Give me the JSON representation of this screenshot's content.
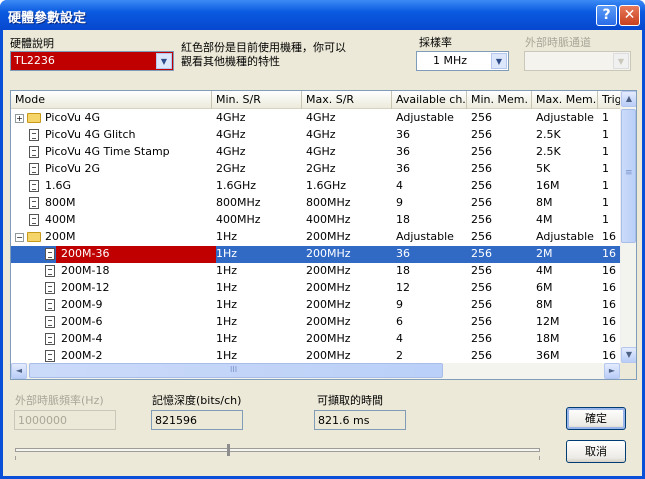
{
  "window": {
    "title": "硬體參數設定",
    "help_glyph": "?",
    "close_glyph": "✕"
  },
  "hardware": {
    "label": "硬體說明",
    "selected": "TL2236",
    "hint_line1": "紅色部份是目前使用機種，你可以",
    "hint_line2": "觀看其他機種的特性"
  },
  "sampling": {
    "label": "採樣率",
    "selected": "1 MHz"
  },
  "ext_clock_channel": {
    "label": "外部時脈通道",
    "selected": ""
  },
  "table": {
    "columns": [
      "Mode",
      "Min. S/R",
      "Max. S/R",
      "Available ch.",
      "Min. Mem.",
      "Max. Mem.",
      "Trig"
    ],
    "rows": [
      {
        "expander": "+",
        "icon": "folder",
        "indent": 0,
        "cells": [
          "PicoVu 4G",
          "4GHz",
          "4GHz",
          "Adjustable",
          "256",
          "Adjustable",
          "1"
        ]
      },
      {
        "expander": "",
        "icon": "doc",
        "indent": 0,
        "cells": [
          "PicoVu 4G Glitch",
          "4GHz",
          "4GHz",
          "36",
          "256",
          "2.5K",
          "1"
        ]
      },
      {
        "expander": "",
        "icon": "doc",
        "indent": 0,
        "cells": [
          "PicoVu 4G Time Stamp",
          "4GHz",
          "4GHz",
          "36",
          "256",
          "2.5K",
          "1"
        ]
      },
      {
        "expander": "",
        "icon": "doc",
        "indent": 0,
        "cells": [
          "PicoVu 2G",
          "2GHz",
          "2GHz",
          "36",
          "256",
          "5K",
          "1"
        ]
      },
      {
        "expander": "",
        "icon": "doc",
        "indent": 0,
        "cells": [
          "1.6G",
          "1.6GHz",
          "1.6GHz",
          "4",
          "256",
          "16M",
          "1"
        ]
      },
      {
        "expander": "",
        "icon": "doc",
        "indent": 0,
        "cells": [
          "800M",
          "800MHz",
          "800MHz",
          "9",
          "256",
          "8M",
          "1"
        ]
      },
      {
        "expander": "",
        "icon": "doc",
        "indent": 0,
        "cells": [
          "400M",
          "400MHz",
          "400MHz",
          "18",
          "256",
          "4M",
          "1"
        ]
      },
      {
        "expander": "−",
        "icon": "folder-open",
        "indent": 0,
        "cells": [
          "200M",
          "1Hz",
          "200MHz",
          "Adjustable",
          "256",
          "Adjustable",
          "16"
        ]
      },
      {
        "expander": "",
        "icon": "doc",
        "indent": 1,
        "selected": true,
        "current": true,
        "cells": [
          "200M-36",
          "1Hz",
          "200MHz",
          "36",
          "256",
          "2M",
          "16"
        ]
      },
      {
        "expander": "",
        "icon": "doc",
        "indent": 1,
        "cells": [
          "200M-18",
          "1Hz",
          "200MHz",
          "18",
          "256",
          "4M",
          "16"
        ]
      },
      {
        "expander": "",
        "icon": "doc",
        "indent": 1,
        "cells": [
          "200M-12",
          "1Hz",
          "200MHz",
          "12",
          "256",
          "6M",
          "16"
        ]
      },
      {
        "expander": "",
        "icon": "doc",
        "indent": 1,
        "cells": [
          "200M-9",
          "1Hz",
          "200MHz",
          "9",
          "256",
          "8M",
          "16"
        ]
      },
      {
        "expander": "",
        "icon": "doc",
        "indent": 1,
        "cells": [
          "200M-6",
          "1Hz",
          "200MHz",
          "6",
          "256",
          "12M",
          "16"
        ]
      },
      {
        "expander": "",
        "icon": "doc",
        "indent": 1,
        "cells": [
          "200M-4",
          "1Hz",
          "200MHz",
          "4",
          "256",
          "18M",
          "16"
        ]
      },
      {
        "expander": "",
        "icon": "doc",
        "indent": 1,
        "cells": [
          "200M-2",
          "1Hz",
          "200MHz",
          "2",
          "256",
          "36M",
          "16"
        ]
      }
    ]
  },
  "ext_clock_freq": {
    "label": "外部時脈頻率(Hz)",
    "value": "1000000"
  },
  "memory_depth": {
    "label": "記憶深度(bits/ch)",
    "value": "821596"
  },
  "capture_time": {
    "label": "可擷取的時間",
    "value": "821.6 ms"
  },
  "buttons": {
    "ok": "確定",
    "cancel": "取消"
  },
  "icons": {
    "combo_arrow": "▼",
    "scroll_up": "▲",
    "scroll_down": "▼",
    "scroll_left": "◄",
    "scroll_right": "►",
    "thumb_grip": "≡",
    "hthumb_grip": "III"
  },
  "colors": {
    "current_mode": "#c00000",
    "selection": "#316ac5"
  }
}
